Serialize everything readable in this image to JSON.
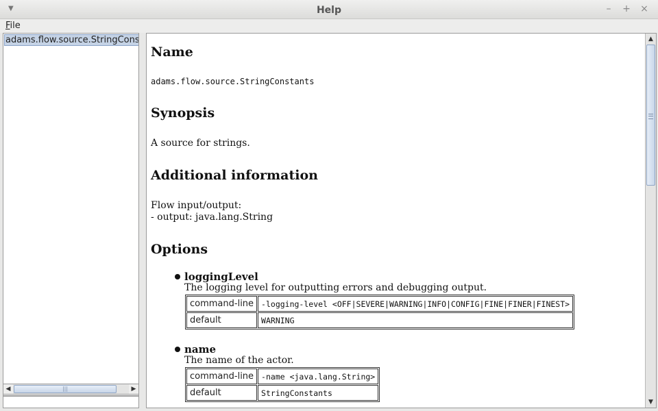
{
  "window": {
    "title": "Help",
    "menu_icon": "window-menu-icon",
    "minimize": "–",
    "maximize": "+",
    "close": "×"
  },
  "menubar": {
    "file_first": "F",
    "file_rest": "ile"
  },
  "sidebar": {
    "items": [
      {
        "label": "adams.flow.source.StringConstants",
        "selected": true
      }
    ]
  },
  "content": {
    "name_heading": "Name",
    "name_value": "adams.flow.source.StringConstants",
    "synopsis_heading": "Synopsis",
    "synopsis_text": "A source for strings.",
    "additional_heading": "Additional information",
    "additional_line1": "Flow input/output:",
    "additional_line2": "- output: java.lang.String",
    "options_heading": "Options",
    "options": [
      {
        "name": "loggingLevel",
        "description": "The logging level for outputting errors and debugging output.",
        "rows": [
          {
            "key": "command-line",
            "value": "-logging-level <OFF|SEVERE|WARNING|INFO|CONFIG|FINE|FINER|FINEST>"
          },
          {
            "key": "default",
            "value": "WARNING"
          }
        ]
      },
      {
        "name": "name",
        "description": "The name of the actor.",
        "rows": [
          {
            "key": "command-line",
            "value": "-name <java.lang.String>"
          },
          {
            "key": "default",
            "value": "StringConstants"
          }
        ]
      }
    ]
  },
  "scroll": {
    "up_arrow": "▲",
    "down_arrow": "▼",
    "left_arrow": "◀",
    "right_arrow": "▶",
    "grip": "|||"
  }
}
